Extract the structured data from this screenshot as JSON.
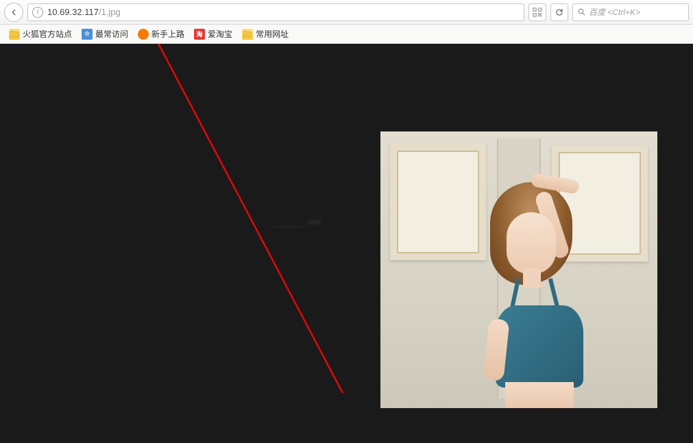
{
  "url": {
    "host": "10.69.32.117",
    "path": "/1.jpg"
  },
  "search": {
    "placeholder": "百度 <Ctrl+K>"
  },
  "bookmarks": [
    {
      "label": "火狐官方站点",
      "iconType": "folder"
    },
    {
      "label": "最常访问",
      "iconType": "blue"
    },
    {
      "label": "新手上路",
      "iconType": "orange"
    },
    {
      "label": "爱淘宝",
      "iconType": "red",
      "iconText": "淘"
    },
    {
      "label": "常用网址",
      "iconType": "folder"
    }
  ],
  "watermark": "______.net"
}
